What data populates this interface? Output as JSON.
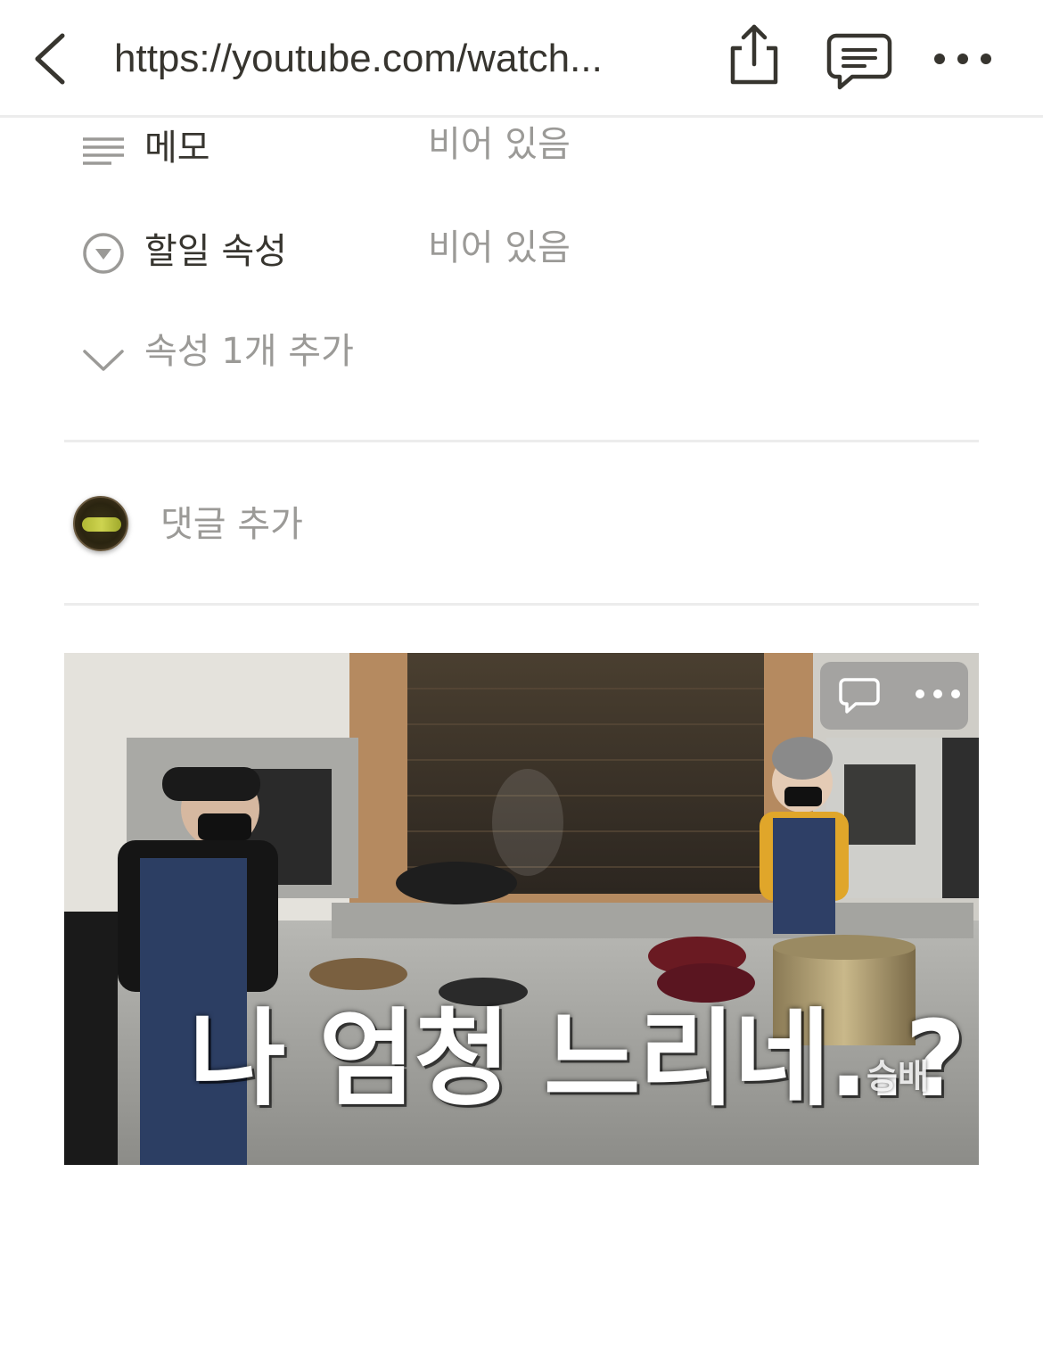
{
  "topbar": {
    "url": "https://youtube.com/watch...",
    "icons": {
      "back": "chevron-left-icon",
      "share": "share-icon",
      "comment": "comment-icon",
      "more": "more-horizontal-icon"
    }
  },
  "properties": [
    {
      "name": "메모",
      "value": "비어 있음",
      "icon": "text-lines-icon"
    },
    {
      "name": "할일 속성",
      "value": "비어 있음",
      "icon": "select-circle-icon"
    }
  ],
  "add_property": {
    "label": "속성 1개 추가",
    "icon": "chevron-down-icon"
  },
  "comment": {
    "placeholder": "댓글 추가"
  },
  "video": {
    "caption": "나 엄청 느리네..?",
    "watermark": "승배"
  },
  "colors": {
    "text": "#37352f",
    "muted": "#9b9a97",
    "divider": "#ececec"
  }
}
